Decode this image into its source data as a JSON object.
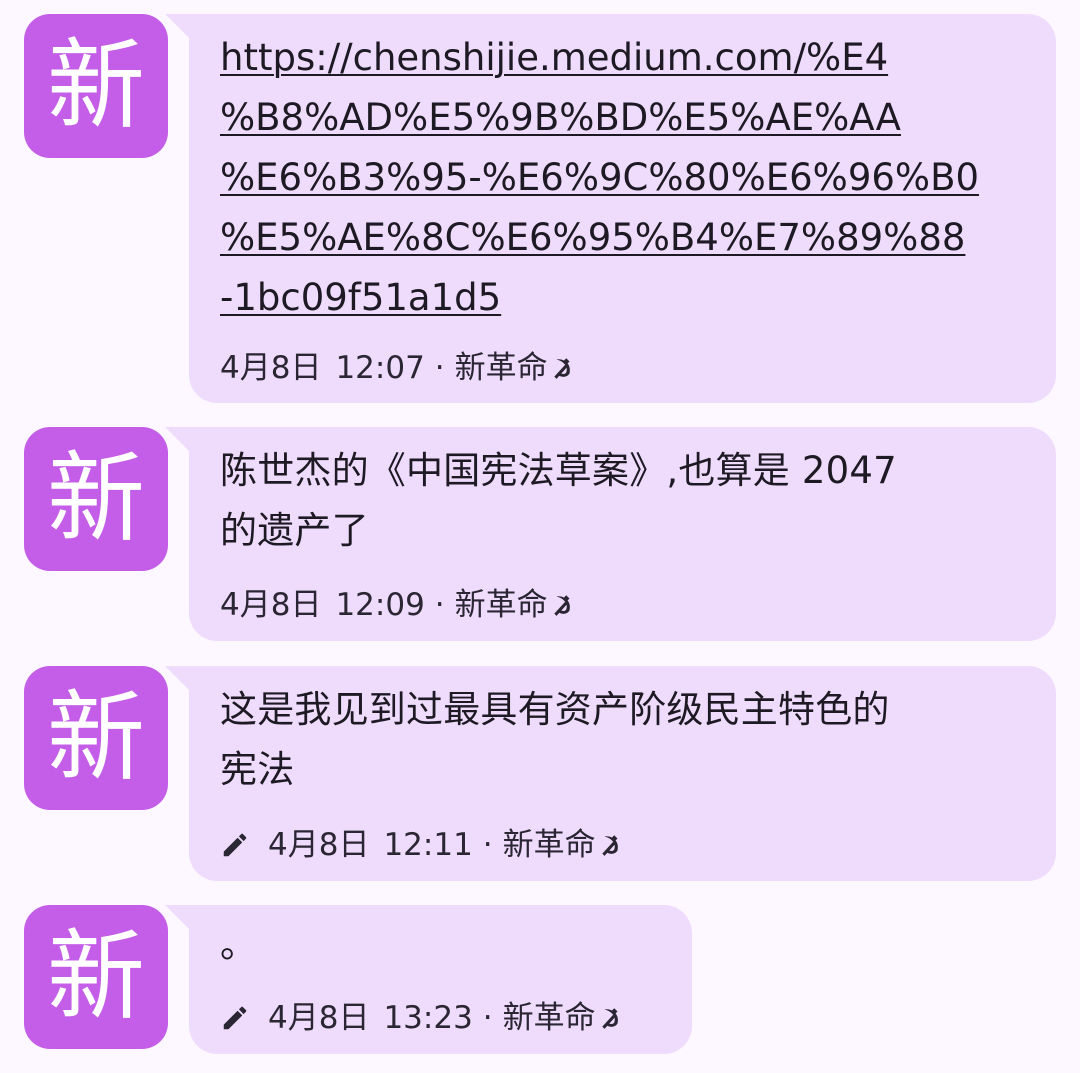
{
  "messages": [
    {
      "avatar_text": "新",
      "text": "https://chenshijie.medium.com/%E4%B8%AD%E5%9B%BD%E5%AE%AA%E6%B3%95-%E6%9C%80%E6%96%B0%E5%AE%8C%E6%95%B4%E7%89%88-1bc09f51a1d5",
      "text_lines": [
        "https://chenshijie.medium.com/%E4",
        "%B8%AD%E5%9B%BD%E5%AE%AA",
        "%E6%B3%95-%E6%9C%80%E6%96%B0",
        "%E5%AE%8C%E6%95%B4%E7%89%88",
        "-1bc09f51a1d5"
      ],
      "date": "4月8日",
      "time": "12:07",
      "sender": "新革命",
      "edited": false
    },
    {
      "avatar_text": "新",
      "text_lines": [
        "陈世杰的《中国宪法草案》,也算是 2047",
        "的遗产了"
      ],
      "date": "4月8日",
      "time": "12:09",
      "sender": "新革命",
      "edited": false
    },
    {
      "avatar_text": "新",
      "text_lines": [
        "这是我见到过最具有资产阶级民主特色的",
        "宪法"
      ],
      "date": "4月8日",
      "time": "12:11",
      "sender": "新革命",
      "edited": true
    },
    {
      "avatar_text": "新",
      "text_lines": [
        "。"
      ],
      "date": "4月8日",
      "time": "13:23",
      "sender": "新革命",
      "edited": true
    }
  ],
  "meta_separator": "·",
  "icons": {
    "edited": "pencil-icon",
    "sender_badge": "hammer-sickle-icon"
  },
  "colors": {
    "background": "#fdf8ff",
    "bubble": "#efdcfd",
    "avatar": "#c45ee8",
    "text": "#1d1a24"
  }
}
